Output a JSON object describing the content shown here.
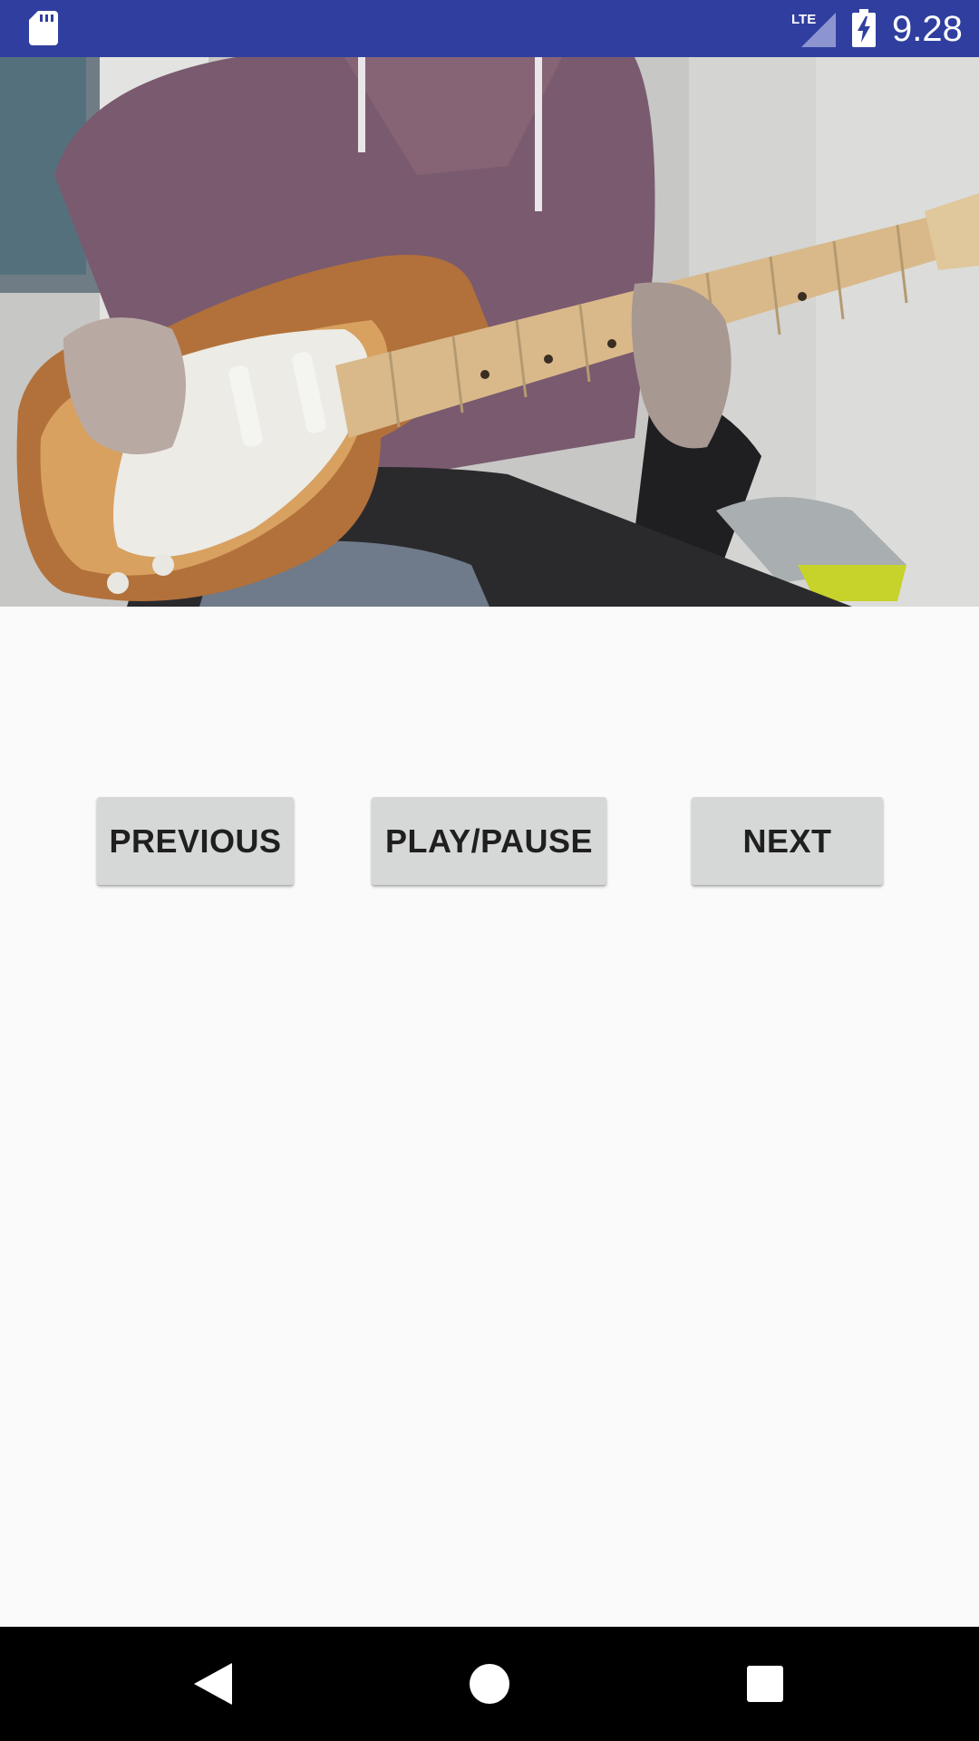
{
  "status_bar": {
    "time": "9.28",
    "network_label": "LTE",
    "background_color": "#303f9f",
    "icons": [
      "sd-card-icon",
      "lte-signal-icon",
      "battery-charging-icon"
    ]
  },
  "video": {
    "icon": "video-frame"
  },
  "controls": {
    "previous_label": "PREVIOUS",
    "play_pause_label": "PLAY/PAUSE",
    "next_label": "NEXT",
    "button_color": "#d6d7d7"
  },
  "nav_bar": {
    "icons": [
      "back-icon",
      "home-icon",
      "recents-icon"
    ]
  }
}
